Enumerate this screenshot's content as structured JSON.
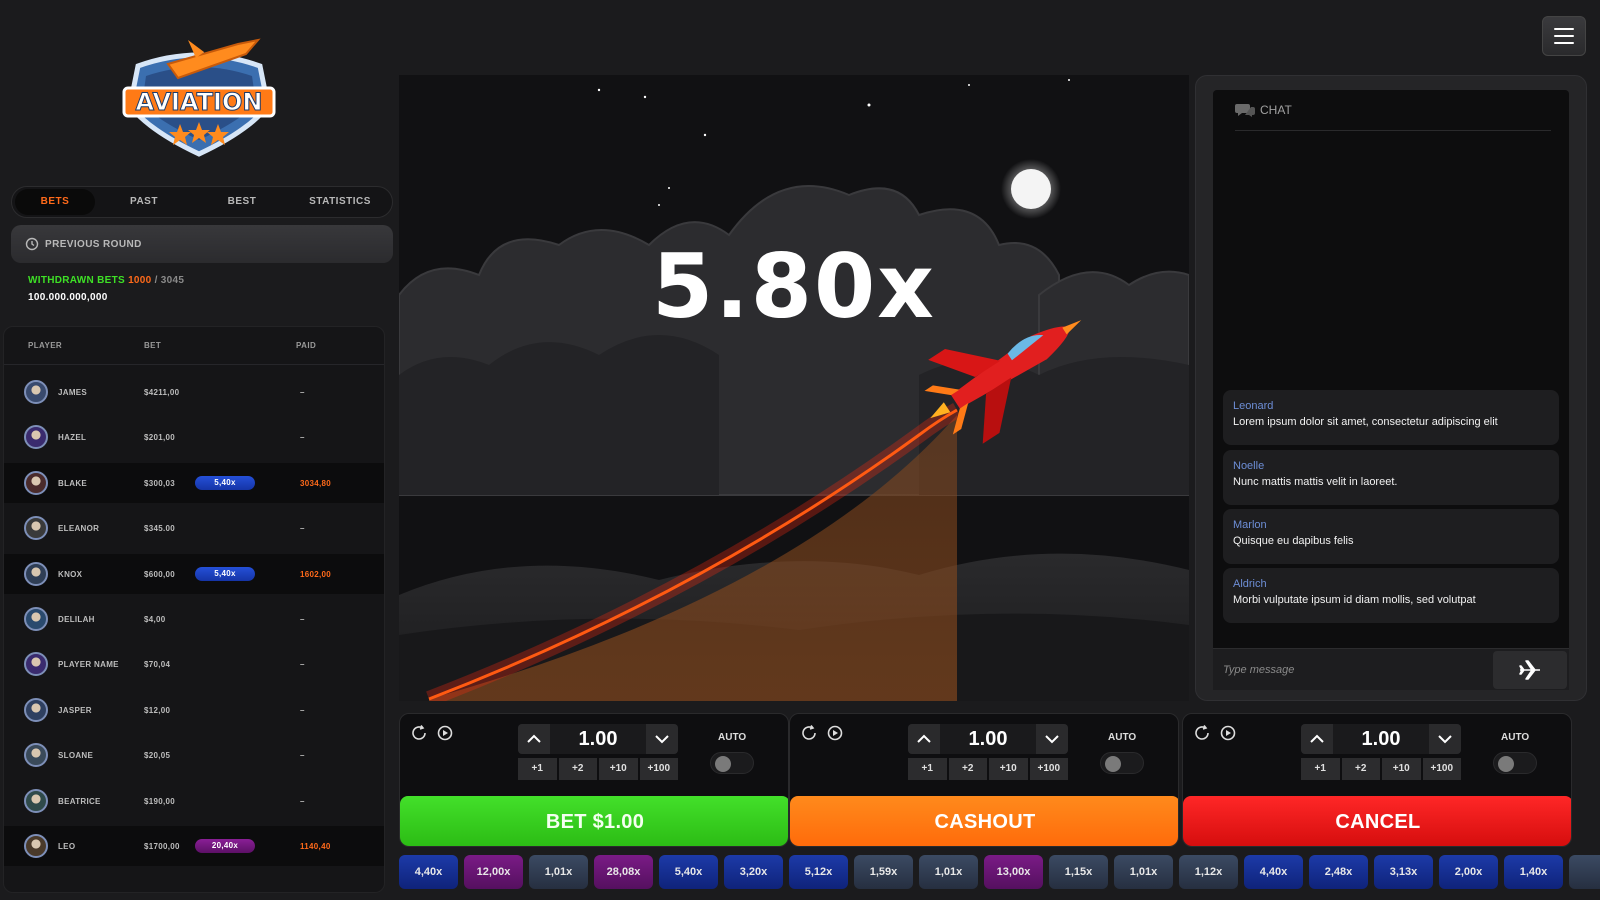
{
  "app": {
    "logo_text": "AVIATION"
  },
  "tabs": [
    {
      "label": "BETS",
      "active": true
    },
    {
      "label": "PAST",
      "active": false
    },
    {
      "label": "BEST",
      "active": false
    },
    {
      "label": "STATISTICS",
      "active": false
    }
  ],
  "previous_round": {
    "label": "PREVIOUS ROUND"
  },
  "withdrawn": {
    "label": "WITHDRAWN BETS",
    "count": "1000",
    "separator": "/",
    "total": "3045",
    "amount": "100.000.000,000"
  },
  "bets_table": {
    "headers": {
      "player": "PLAYER",
      "bet": "BET",
      "paid": "PAID"
    },
    "rows": [
      {
        "name": "JAMES",
        "bet": "$4211,00",
        "mult": "",
        "paid": "–",
        "win": false
      },
      {
        "name": "HAZEL",
        "bet": "$201,00",
        "mult": "",
        "paid": "–",
        "win": false
      },
      {
        "name": "BLAKE",
        "bet": "$300,03",
        "mult": "5,40x",
        "paid": "3034,80",
        "win": true,
        "mult_color": "blue"
      },
      {
        "name": "ELEANOR",
        "bet": "$345.00",
        "mult": "",
        "paid": "–",
        "win": false
      },
      {
        "name": "KNOX",
        "bet": "$600,00",
        "mult": "5,40x",
        "paid": "1602,00",
        "win": true,
        "mult_color": "blue"
      },
      {
        "name": "DELILAH",
        "bet": "$4,00",
        "mult": "",
        "paid": "–",
        "win": false
      },
      {
        "name": "PLAYER NAME",
        "bet": "$70,04",
        "mult": "",
        "paid": "–",
        "win": false
      },
      {
        "name": "JASPER",
        "bet": "$12,00",
        "mult": "",
        "paid": "–",
        "win": false
      },
      {
        "name": "SLOANE",
        "bet": "$20,05",
        "mult": "",
        "paid": "–",
        "win": false
      },
      {
        "name": "BEATRICE",
        "bet": "$190,00",
        "mult": "",
        "paid": "–",
        "win": false
      },
      {
        "name": "LEO",
        "bet": "$1700,00",
        "mult": "20,40x",
        "paid": "1140,40",
        "win": true,
        "mult_color": "purple"
      }
    ]
  },
  "game": {
    "multiplier": "5.80x"
  },
  "chat": {
    "title": "CHAT",
    "messages": [
      {
        "user": "Leonard",
        "text": "Lorem ipsum dolor sit amet, consectetur adipiscing elit"
      },
      {
        "user": "Noelle",
        "text": "Nunc mattis mattis velit in laoreet."
      },
      {
        "user": "Marlon",
        "text": "Quisque eu dapibus felis"
      },
      {
        "user": "Aldrich",
        "text": "Morbi vulputate ipsum id diam mollis, sed volutpat"
      }
    ],
    "input_placeholder": "Type message"
  },
  "bet_panels": [
    {
      "value": "1.00",
      "quick": [
        "+1",
        "+2",
        "+10",
        "+100"
      ],
      "auto_label": "AUTO",
      "action": "BET $1.00",
      "action_type": "bet"
    },
    {
      "value": "1.00",
      "quick": [
        "+1",
        "+2",
        "+10",
        "+100"
      ],
      "auto_label": "AUTO",
      "action": "CASHOUT",
      "action_type": "cashout"
    },
    {
      "value": "1.00",
      "quick": [
        "+1",
        "+2",
        "+10",
        "+100"
      ],
      "auto_label": "AUTO",
      "action": "CANCEL",
      "action_type": "cancel"
    }
  ],
  "history": [
    {
      "v": "4,40x",
      "c": "blue"
    },
    {
      "v": "12,00x",
      "c": "purple"
    },
    {
      "v": "1,01x",
      "c": "gray"
    },
    {
      "v": "28,08x",
      "c": "purple"
    },
    {
      "v": "5,40x",
      "c": "blue"
    },
    {
      "v": "3,20x",
      "c": "blue"
    },
    {
      "v": "5,12x",
      "c": "blue"
    },
    {
      "v": "1,59x",
      "c": "gray"
    },
    {
      "v": "1,01x",
      "c": "gray"
    },
    {
      "v": "13,00x",
      "c": "purple"
    },
    {
      "v": "1,15x",
      "c": "gray"
    },
    {
      "v": "1,01x",
      "c": "gray"
    },
    {
      "v": "1,12x",
      "c": "gray"
    },
    {
      "v": "4,40x",
      "c": "blue"
    },
    {
      "v": "2,48x",
      "c": "blue"
    },
    {
      "v": "3,13x",
      "c": "blue"
    },
    {
      "v": "2,00x",
      "c": "blue"
    },
    {
      "v": "1,40x",
      "c": "blue"
    },
    {
      "v": "",
      "c": "gray"
    }
  ],
  "colors": {
    "accent": "#ff6a1a",
    "green": "#3ee026",
    "bet_green": "#2bbb14",
    "cashout_orange": "#ff6a0a",
    "cancel_red": "#d40d0d",
    "chat_user": "#6d8ed6"
  }
}
